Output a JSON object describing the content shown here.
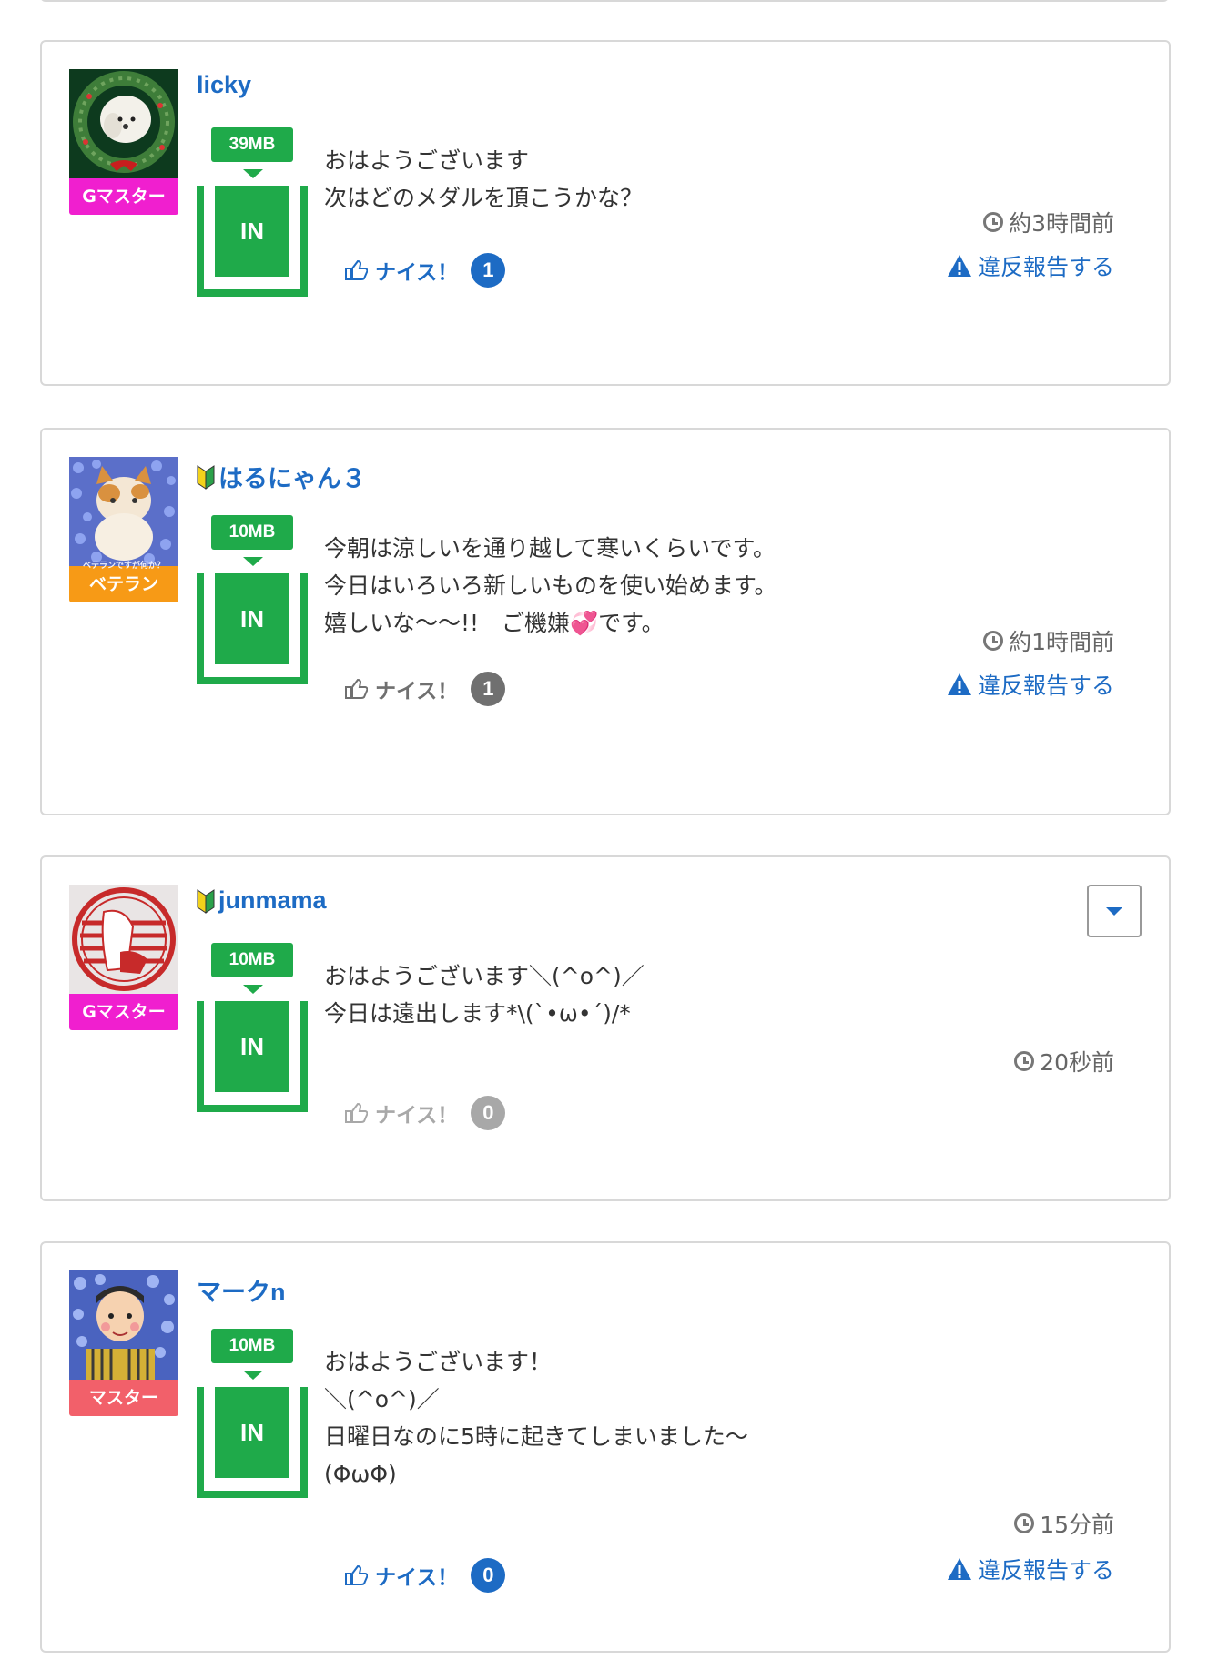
{
  "colors": {
    "link_blue": "#1d6bc4",
    "storage_green": "#1faa4a",
    "rank_gmaster": "#f01fcf",
    "rank_veteran": "#f79a16",
    "rank_master": "#f2606a",
    "border": "#d8d8d8"
  },
  "posts": [
    {
      "username": "licky",
      "beginner_mark": false,
      "rank": "Gマスター",
      "rank_type": "gmaster",
      "storage": "39MB",
      "storage_label": "IN",
      "message": "おはようございます\n次はどのメダルを頂こうかな？",
      "time": "約3時間前",
      "nice_label": "ナイス！",
      "nice_count": "1",
      "nice_state": "active",
      "report_label": "違反報告する",
      "icons": {
        "time": "clock-icon",
        "report": "warning-icon",
        "nice": "thumbs-up-icon"
      }
    },
    {
      "username": "はるにゃん３",
      "beginner_mark": true,
      "rank": "ベテラン",
      "rank_sub": "ベテランですが何か？",
      "rank_type": "veteran",
      "storage": "10MB",
      "storage_label": "IN",
      "message": "今朝は涼しいを通り越して寒いくらいです。\n今日はいろいろ新しいものを使い始めます。\n嬉しいな〜〜!!　ご機嫌💞です。",
      "time": "約1時間前",
      "nice_label": "ナイス！",
      "nice_count": "1",
      "nice_state": "dark",
      "report_label": "違反報告する"
    },
    {
      "username": "junmama",
      "beginner_mark": true,
      "rank": "Gマスター",
      "rank_type": "gmaster",
      "storage": "10MB",
      "storage_label": "IN",
      "message": "おはようございます＼(^o^)／\n今日は遠出します*\\(`•ω•´)/*",
      "time": "20秒前",
      "nice_label": "ナイス！",
      "nice_count": "0",
      "nice_state": "muted"
    },
    {
      "username": "マークn",
      "beginner_mark": false,
      "rank": "マスター",
      "rank_type": "master",
      "storage": "10MB",
      "storage_label": "IN",
      "message": "おはようございます！\n＼(^o^)／\n日曜日なのに5時に起きてしまいました〜\n(ΦωΦ)",
      "time": "15分前",
      "nice_label": "ナイス！",
      "nice_count": "0",
      "nice_state": "active",
      "report_label": "違反報告する"
    }
  ]
}
